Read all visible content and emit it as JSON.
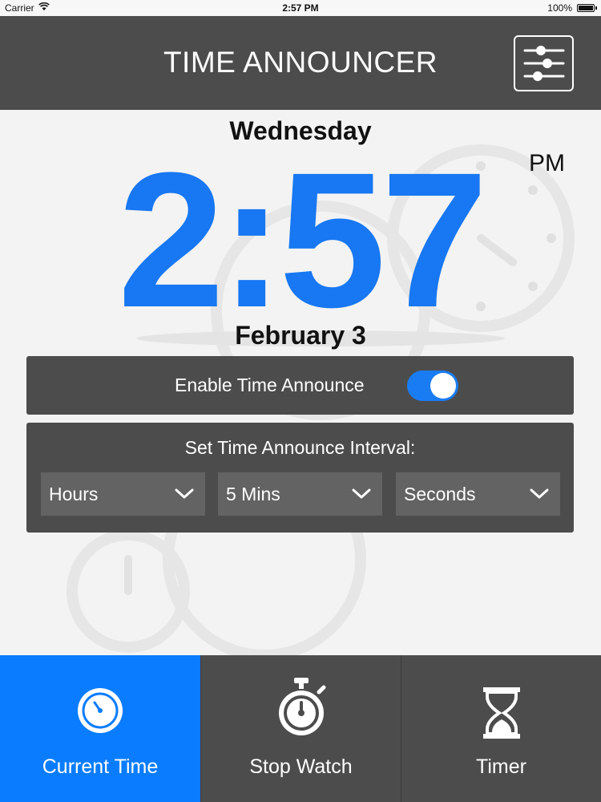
{
  "status_bar": {
    "carrier": "Carrier",
    "time": "2:57 PM",
    "battery": "100%"
  },
  "header": {
    "title": "TIME ANNOUNCER",
    "settings_icon": "sliders-icon"
  },
  "clock": {
    "day": "Wednesday",
    "time": "2:57",
    "ampm": "PM",
    "date": "February 3",
    "color": "#1877f2"
  },
  "announce": {
    "label": "Enable Time Announce",
    "enabled": true
  },
  "interval": {
    "label": "Set Time Announce Interval:",
    "hours": "Hours",
    "minutes": "5 Mins",
    "seconds": "Seconds"
  },
  "tabs": [
    {
      "label": "Current Time",
      "icon": "clock-icon",
      "active": true
    },
    {
      "label": "Stop Watch",
      "icon": "stopwatch-icon",
      "active": false
    },
    {
      "label": "Timer",
      "icon": "hourglass-icon",
      "active": false
    }
  ],
  "colors": {
    "bar": "#4d4c4d",
    "accent": "#0a7cff"
  }
}
